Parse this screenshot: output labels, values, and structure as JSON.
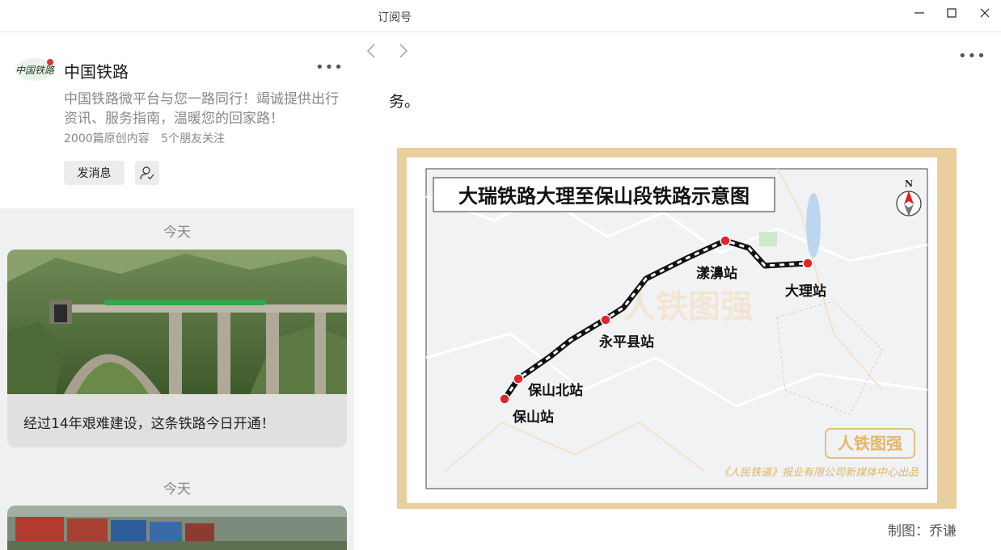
{
  "window": {
    "title": "订阅号"
  },
  "account": {
    "name": "中国铁路",
    "avatar_text": "中国铁路",
    "description": "中国铁路微平台与您一路同行！竭诚提供出行资讯、服务指南，温暖您的回家路！",
    "original_count": "2000篇原创内容",
    "friends_follow": "5个朋友关注",
    "send_message": "发消息"
  },
  "feed": [
    {
      "date": "今天",
      "title": "经过14年艰难建设，这条铁路今日开通！"
    },
    {
      "date": "今天",
      "title": ""
    }
  ],
  "article": {
    "text_fragment": "务。",
    "map_title": "大瑞铁路大理至保山段铁路示意图",
    "compass": "N",
    "stations": [
      {
        "name": "大理站"
      },
      {
        "name": "漾濞站"
      },
      {
        "name": "永平县站"
      },
      {
        "name": "保山北站"
      },
      {
        "name": "保山站"
      }
    ],
    "watermark": "人铁图强",
    "map_credit": "《人民铁道》报业有限公司新媒体中心出品",
    "credit": "制图：乔谦"
  }
}
